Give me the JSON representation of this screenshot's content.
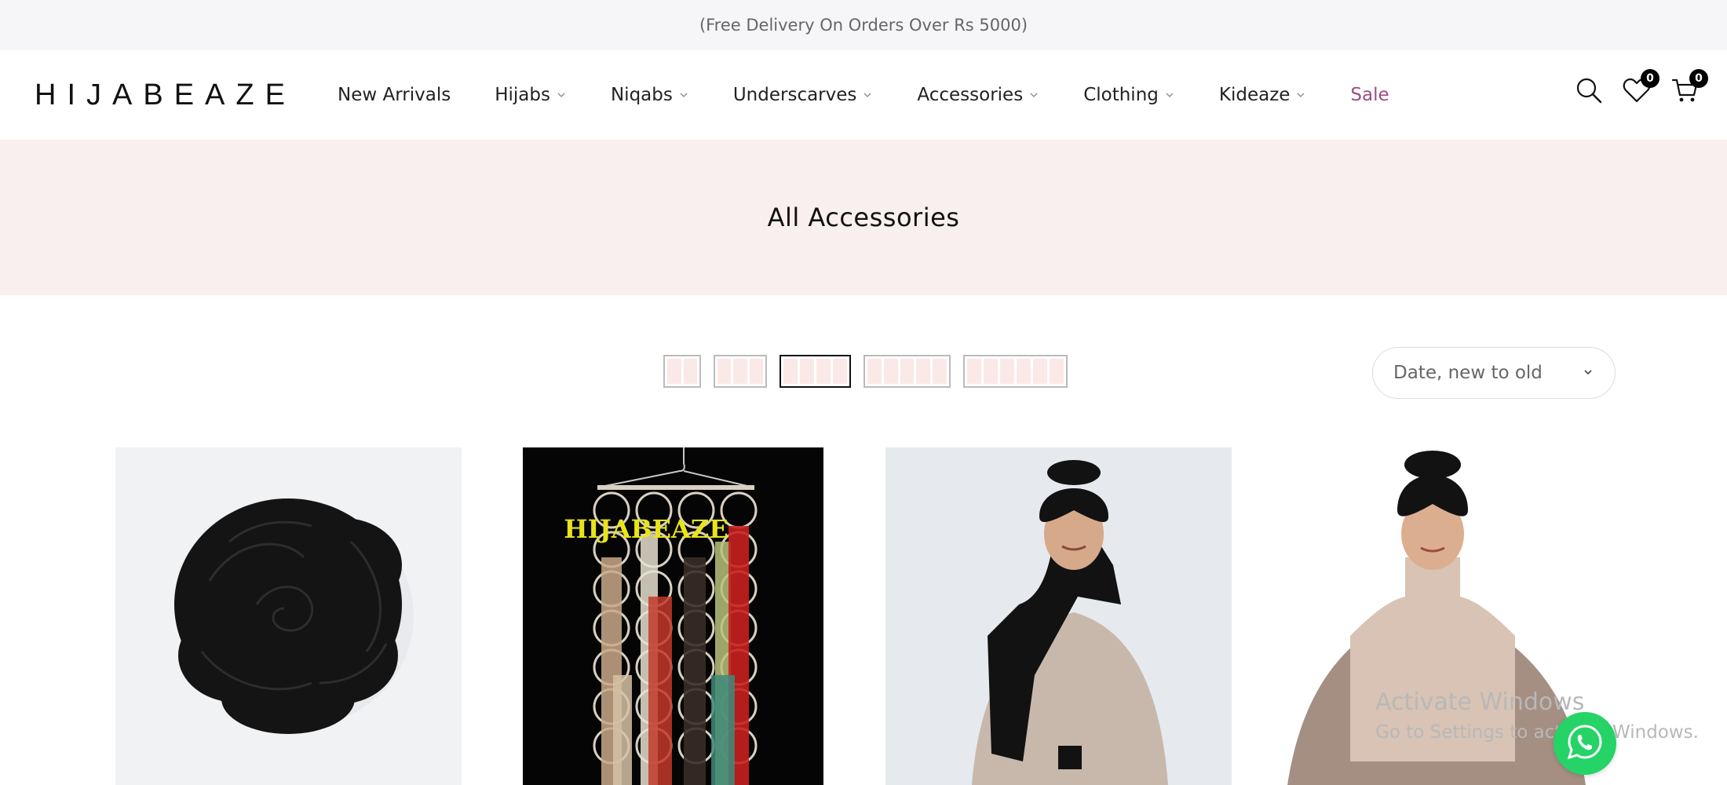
{
  "announcement": "(Free Delivery On Orders Over Rs 5000)",
  "brand": {
    "logo_text": "HIJABEAZE"
  },
  "nav": {
    "items": [
      {
        "label": "New Arrivals",
        "has_dropdown": false
      },
      {
        "label": "Hijabs",
        "has_dropdown": true
      },
      {
        "label": "Niqabs",
        "has_dropdown": true
      },
      {
        "label": "Underscarves",
        "has_dropdown": true
      },
      {
        "label": "Accessories",
        "has_dropdown": true
      },
      {
        "label": "Clothing",
        "has_dropdown": true
      },
      {
        "label": "Kideaze",
        "has_dropdown": true
      },
      {
        "label": "Sale",
        "has_dropdown": false
      }
    ]
  },
  "header_icons": {
    "search": "search-icon",
    "wishlist": {
      "icon": "heart-icon",
      "count": "0"
    },
    "cart": {
      "icon": "cart-icon",
      "count": "0"
    }
  },
  "page": {
    "title": "All Accessories"
  },
  "toolbar": {
    "grid_options": [
      2,
      3,
      4,
      5,
      6
    ],
    "active_grid": 4,
    "sort": {
      "selected": "Date, new to old"
    }
  },
  "products": [
    {
      "image": "black-flower-hijab-pin"
    },
    {
      "image": "hijab-organizer-hanger",
      "image_text": "HIJABEAZE"
    },
    {
      "image": "model-black-turban-cape"
    },
    {
      "image": "model-black-turban-beige-collar"
    }
  ],
  "watermark": {
    "line1": "Activate Windows",
    "line2": "Go to Settings to activate Windows."
  },
  "colors": {
    "sale": "#9b4f84",
    "hero_bg": "#f9efee",
    "topbar_bg": "#f6f6f8",
    "whatsapp": "#25d366"
  }
}
